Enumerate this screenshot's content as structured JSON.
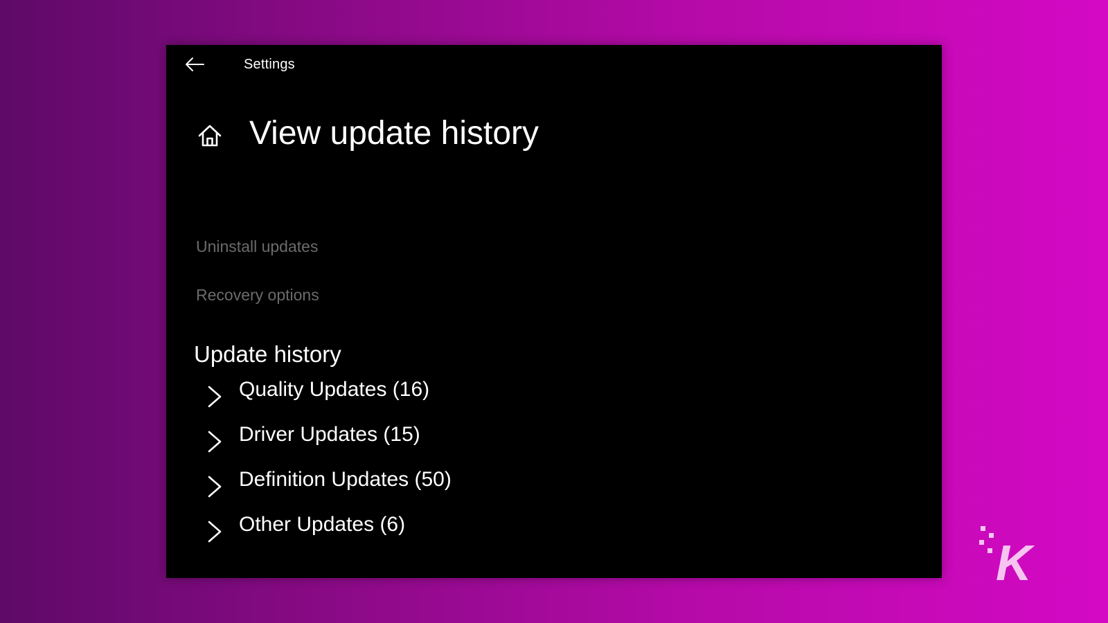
{
  "window": {
    "app_title": "Settings",
    "back_icon": "arrow-left-icon",
    "home_icon": "home-icon"
  },
  "page": {
    "title": "View update history",
    "links": {
      "uninstall": "Uninstall updates",
      "recovery": "Recovery options"
    },
    "section_title": "Update history",
    "updates": [
      {
        "label": "Quality Updates (16)"
      },
      {
        "label": "Driver Updates (15)"
      },
      {
        "label": "Definition Updates (50)"
      },
      {
        "label": "Other Updates (6)"
      }
    ]
  },
  "colors": {
    "window_bg": "#000000",
    "text": "#ffffff",
    "dim_link": "#6b6b6b",
    "background_left": "#5e0a68",
    "background_right": "#d409c4",
    "logo": "#f5c4f0"
  },
  "watermark": {
    "icon": "k-logo-icon",
    "text": "K"
  }
}
